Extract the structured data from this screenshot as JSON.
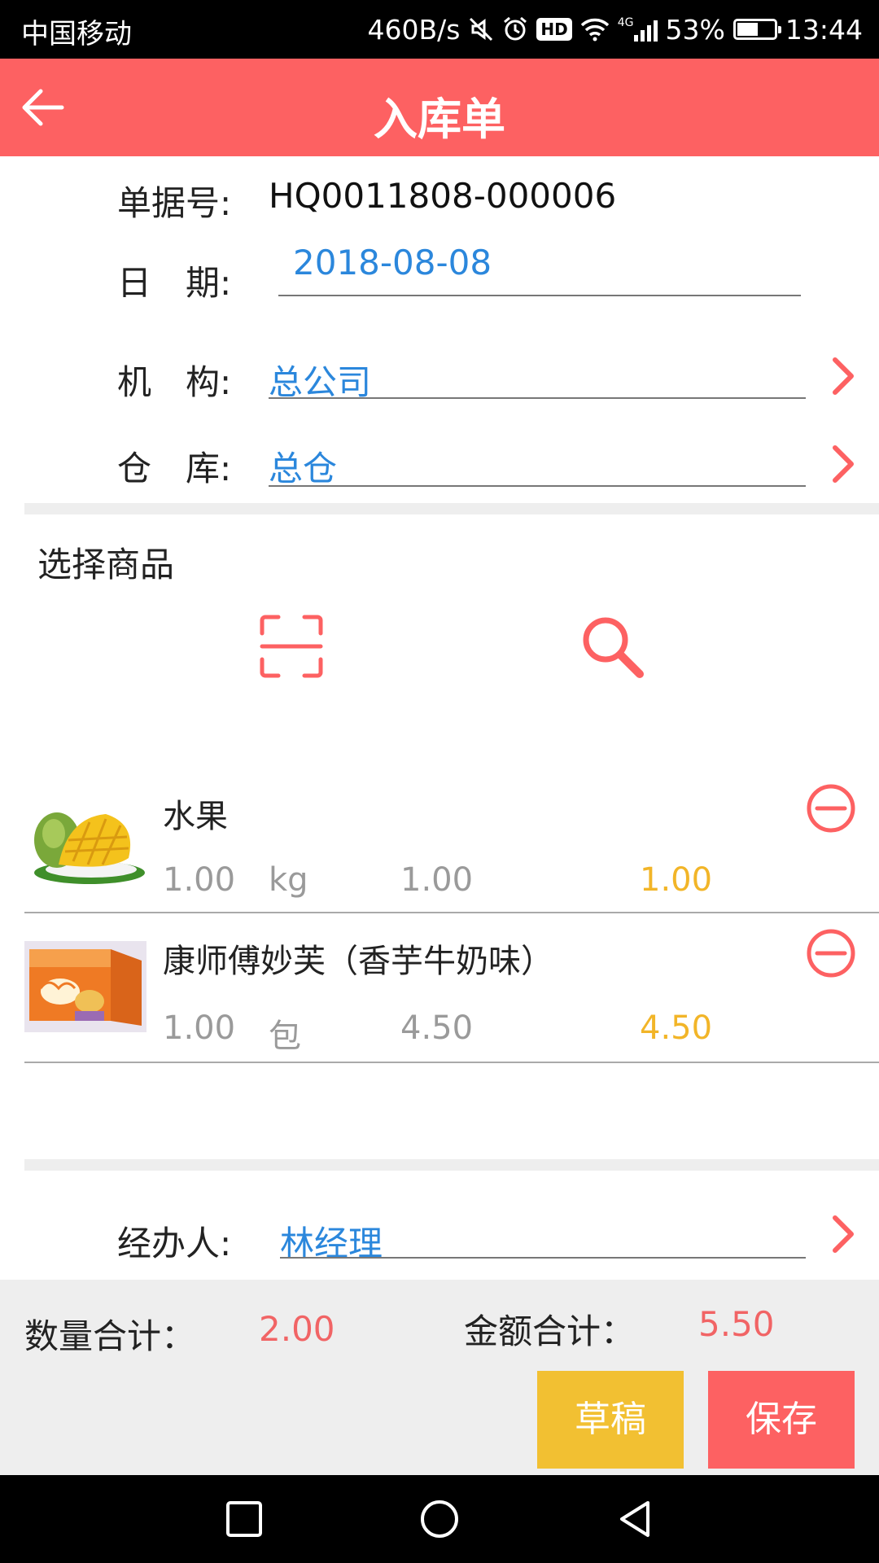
{
  "status_bar": {
    "carrier": "中国移动",
    "net_speed": "460B/s",
    "hd": "HD",
    "network": "4G",
    "battery_percent": "53%",
    "battery_level": 0.53,
    "time": "13:44",
    "icons": [
      "mute-icon",
      "alarm-icon",
      "hd-icon",
      "wifi-icon",
      "signal-icon",
      "battery-icon"
    ]
  },
  "header": {
    "title": "入库单",
    "back_icon": "arrow-left-icon"
  },
  "form": {
    "doc_no_label": "单据号:",
    "doc_no": "HQ0011808-000006",
    "date_label": "日　期:",
    "date": "2018-08-08",
    "org_label": "机　构:",
    "org": "总公司",
    "warehouse_label": "仓　库:",
    "warehouse": "总仓"
  },
  "select_goods": {
    "title": "选择商品",
    "scan_icon": "scan-icon",
    "search_icon": "search-icon"
  },
  "products": [
    {
      "name": "水果",
      "qty": "1.00",
      "unit": "kg",
      "price": "1.00",
      "amount": "1.00",
      "image": "mango-image"
    },
    {
      "name": "康师傅妙芙（香芋牛奶味）",
      "qty": "1.00",
      "unit": "包",
      "price": "4.50",
      "amount": "4.50",
      "image": "cake-box-image"
    }
  ],
  "handler": {
    "label": "经办人:",
    "value": "林经理"
  },
  "summary": {
    "qty_label": "数量合计：",
    "qty_total": "2.00",
    "amount_label": "金额合计：",
    "amount_total": "5.50",
    "draft_button": "草稿",
    "save_button": "保存"
  },
  "colors": {
    "accent": "#fd6162",
    "link_blue": "#2b87dc",
    "amount_yellow": "#f2b528",
    "draft_yellow": "#f2c032"
  }
}
